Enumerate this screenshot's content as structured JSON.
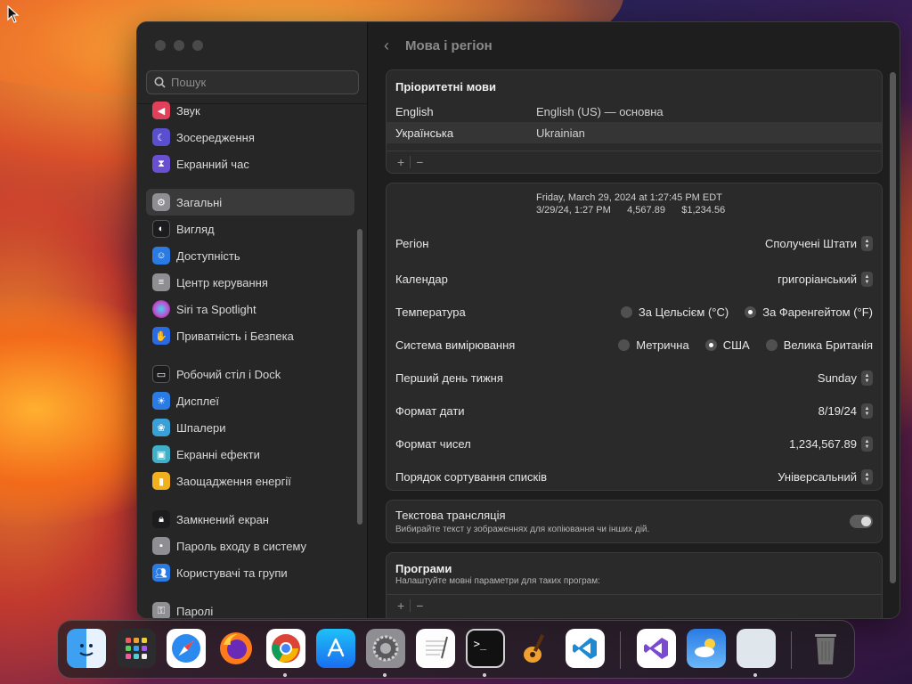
{
  "window": {
    "title": "Мова і регіон"
  },
  "search": {
    "placeholder": "Пошук"
  },
  "sidebar": {
    "items": [
      {
        "label": "Звук",
        "icon": "speaker-icon",
        "color": "#e0405a"
      },
      {
        "label": "Зосередження",
        "icon": "moon-icon",
        "color": "#5a4fcf"
      },
      {
        "label": "Екранний час",
        "icon": "hourglass-icon",
        "color": "#6a4fd0"
      },
      {
        "label": "Загальні",
        "icon": "gear-icon",
        "color": "#8e8e93",
        "selected": true
      },
      {
        "label": "Вигляд",
        "icon": "appearance-icon",
        "color": "#1c1c1e"
      },
      {
        "label": "Доступність",
        "icon": "accessibility-icon",
        "color": "#2a7be4"
      },
      {
        "label": "Центр керування",
        "icon": "control-center-icon",
        "color": "#8e8e93"
      },
      {
        "label": "Siri та Spotlight",
        "icon": "siri-icon",
        "color": "#c04ad0"
      },
      {
        "label": "Приватність і Безпека",
        "icon": "hand-icon",
        "color": "#2a6be4"
      },
      {
        "label": "Робочий стіл і Dock",
        "icon": "dock-icon",
        "color": "#1c1c1e"
      },
      {
        "label": "Дисплеї",
        "icon": "sun-icon",
        "color": "#2a7be4"
      },
      {
        "label": "Шпалери",
        "icon": "wallpaper-icon",
        "color": "#3aa0d8"
      },
      {
        "label": "Екранні ефекти",
        "icon": "screensaver-icon",
        "color": "#40b0c8"
      },
      {
        "label": "Заощадження енергії",
        "icon": "battery-icon",
        "color": "#f0b020"
      },
      {
        "label": "Замкнений екран",
        "icon": "lock-icon",
        "color": "#1c1c1e"
      },
      {
        "label": "Пароль входу в систему",
        "icon": "password-icon",
        "color": "#8e8e93"
      },
      {
        "label": "Користувачі та групи",
        "icon": "users-icon",
        "color": "#2a7be4"
      },
      {
        "label": "Паролі",
        "icon": "key-icon",
        "color": "#8e8e93"
      }
    ]
  },
  "languages": {
    "heading": "Пріоритетні мови",
    "rows": [
      {
        "name": "English",
        "detail": "English (US) — основна"
      },
      {
        "name": "Українська",
        "detail": "Ukrainian"
      }
    ],
    "add_label": "+",
    "remove_label": "−"
  },
  "region": {
    "preview_line1": "Friday, March 29, 2024 at 1:27:45 PM EDT",
    "preview_line2": "3/29/24, 1:27 PM      4,567.89      $1,234.56",
    "rows": {
      "region": {
        "label": "Регіон",
        "value": "Сполучені Штати"
      },
      "calendar": {
        "label": "Календар",
        "value": "григоріанський"
      },
      "temperature": {
        "label": "Температура",
        "options": [
          "За Цельсієм (°C)",
          "За Фаренгейтом (°F)"
        ],
        "selected": 1
      },
      "measurement": {
        "label": "Система вимірювання",
        "options": [
          "Метрична",
          "США",
          "Велика Британія"
        ],
        "selected": 1
      },
      "first_day": {
        "label": "Перший день тижня",
        "value": "Sunday"
      },
      "date_format": {
        "label": "Формат дати",
        "value": "8/19/24"
      },
      "number_format": {
        "label": "Формат чисел",
        "value": "1,234,567.89"
      },
      "sort_order": {
        "label": "Порядок сортування списків",
        "value": "Універсальний"
      }
    }
  },
  "live_text": {
    "title": "Текстова трансляція",
    "subtitle": "Вибирайте текст у зображеннях для копіювання чи інших дій.",
    "enabled": true
  },
  "apps": {
    "title": "Програми",
    "subtitle": "Налаштуйте мовні параметри для таких програм:",
    "add_label": "+",
    "remove_label": "−"
  },
  "dock": {
    "apps": [
      "finder-icon",
      "launchpad-icon",
      "safari-icon",
      "firefox-icon",
      "chrome-icon",
      "app-store-icon",
      "system-settings-icon",
      "textedit-icon",
      "terminal-icon",
      "garageband-icon",
      "vscode-icon",
      "visual-studio-icon",
      "weather-icon",
      "preview-icon",
      "trash-icon"
    ]
  }
}
